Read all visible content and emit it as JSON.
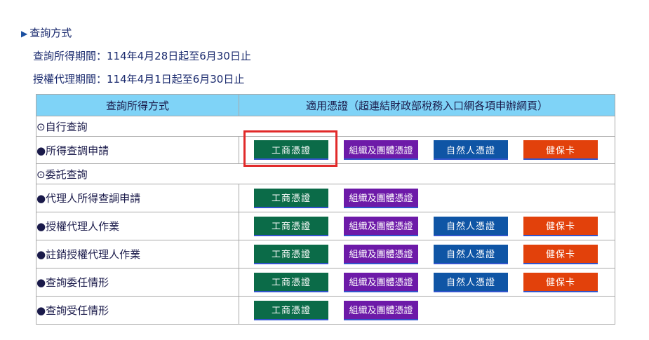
{
  "heading": {
    "marker": "▶",
    "title": "查詢方式"
  },
  "periods": {
    "query": "查詢所得期間：114年4月28日起至6月30日止",
    "agent": "授權代理期間：114年4月1日起至6月30日止"
  },
  "table": {
    "headers": [
      "查詢所得方式",
      "適用憑證（超連結財政部稅務入口網各項申辦網頁）"
    ],
    "sections": {
      "self": "⊙自行查詢",
      "delegate": "⊙委託查詢"
    },
    "rows": [
      {
        "label": "●所得查調申請",
        "buttons": [
          "工商憑證",
          "組織及團體憑證",
          "自然人憑證",
          "健保卡"
        ]
      },
      {
        "label": "●代理人所得查調申請",
        "buttons": [
          "工商憑證",
          "組織及團體憑證"
        ]
      },
      {
        "label": "●授權代理人作業",
        "buttons": [
          "工商憑證",
          "組織及團體憑證",
          "自然人憑證",
          "健保卡"
        ]
      },
      {
        "label": "●註銷授權代理人作業",
        "buttons": [
          "工商憑證",
          "組織及團體憑證",
          "自然人憑證",
          "健保卡"
        ]
      },
      {
        "label": "●查詢委任情形",
        "buttons": [
          "工商憑證",
          "組織及團體憑證",
          "自然人憑證",
          "健保卡"
        ]
      },
      {
        "label": "●查詢受任情形",
        "buttons": [
          "工商憑證",
          "組織及團體憑證"
        ]
      }
    ]
  },
  "colors": {
    "header_bg": "#7fd3f7",
    "business_cert": "#0b6b48",
    "org_cert": "#6d1aa8",
    "citizen_cert": "#0f55a5",
    "nhi_card": "#e2410b",
    "highlight": "#e12a2a"
  }
}
